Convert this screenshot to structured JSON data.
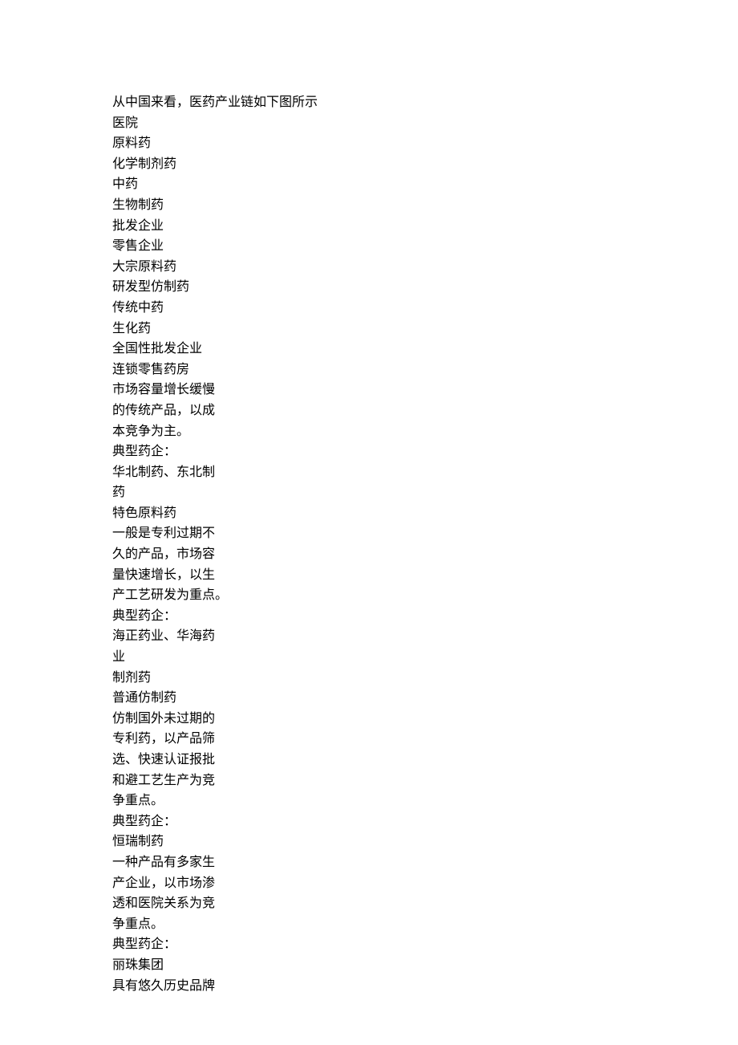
{
  "lines": [
    "从中国来看，医药产业链如下图所示",
    "医院",
    "原料药",
    "化学制剂药",
    "中药",
    "生物制药",
    "批发企业",
    "零售企业",
    "大宗原料药",
    "研发型仿制药",
    "传统中药",
    "生化药",
    "全国性批发企业",
    "连锁零售药房",
    "市场容量增长缓慢",
    "的传统产品，以成",
    "本竞争为主。",
    "典型药企：",
    "华北制药、东北制",
    "药",
    "特色原料药",
    "一般是专利过期不",
    "久的产品，市场容",
    "量快速增长，以生",
    "产工艺研发为重点。",
    "典型药企：",
    "海正药业、华海药",
    "业",
    "制剂药",
    "普通仿制药",
    "仿制国外未过期的",
    "专利药，以产品筛",
    "选、快速认证报批",
    "和避工艺生产为竞",
    "争重点。",
    "典型药企：",
    "恒瑞制药",
    "一种产品有多家生",
    "产企业，以市场渗",
    "透和医院关系为竞",
    "争重点。",
    "典型药企：",
    "丽珠集团",
    "具有悠久历史品牌"
  ]
}
